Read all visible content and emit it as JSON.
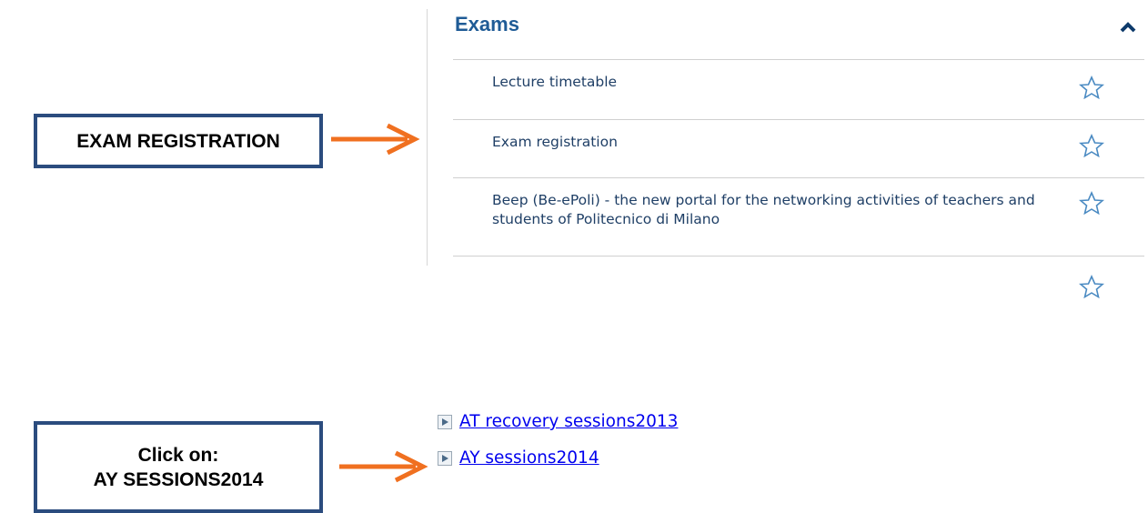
{
  "callouts": {
    "exam_registration": "EXAM REGISTRATION",
    "click_on_line1": "Click on:",
    "click_on_line2": "AY SESSIONS2014"
  },
  "exams_panel": {
    "title": "Exams",
    "items": [
      {
        "label": "Lecture timetable"
      },
      {
        "label": "Exam registration"
      },
      {
        "label": "Beep (Be-ePoli) - the new portal for the networking activities of teachers and students of Politecnico di Milano"
      },
      {
        "label": ""
      }
    ]
  },
  "session_links": [
    {
      "label": "AT recovery sessions2013"
    },
    {
      "label": "AY sessions2014"
    }
  ],
  "colors": {
    "callout_border": "#2b4c7e",
    "arrow": "#f07020",
    "panel_title": "#1f5b96",
    "item_text": "#1f3f66",
    "link": "#0000ee"
  }
}
